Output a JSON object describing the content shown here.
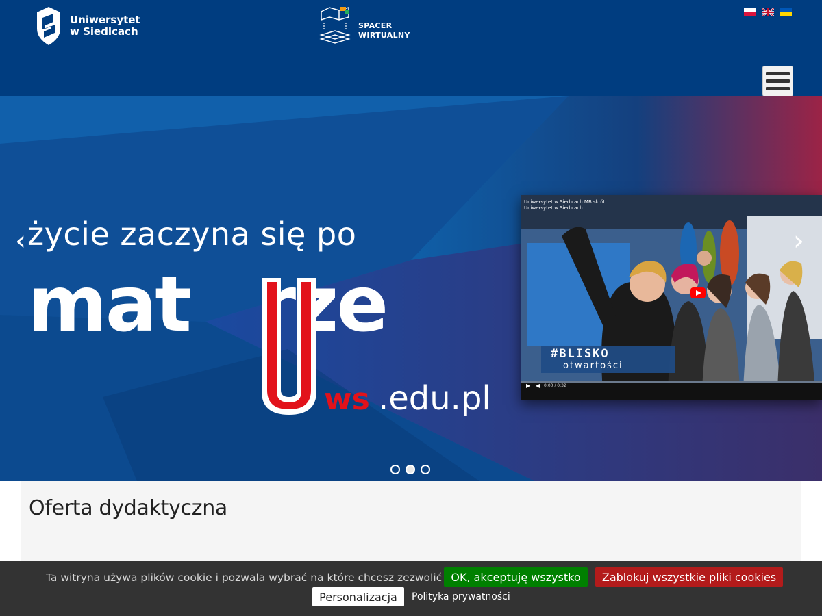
{
  "header": {
    "logo_line1": "Uniwersytet",
    "logo_line2": "w Siedlcach",
    "spacer_line1": "SPACER",
    "spacer_line2": "WIRTUALNY",
    "languages": [
      "pl",
      "en",
      "uk"
    ]
  },
  "hero": {
    "line1": "życie zaczyna się po",
    "big_left": "mat",
    "big_right": "rze",
    "ws": "ws",
    "edu": ".edu.pl",
    "prev_glyph": "‹",
    "next_glyph": "›",
    "video": {
      "caption_line1": "Uniwersytet w Siedlcach MB skrót",
      "caption_line2": "Uniwersytet w Siedlcach",
      "blisko": "#BLISKO",
      "otwartosci": "otwartości",
      "time": "0:00 / 0:32"
    },
    "slides_total": 3,
    "active_slide": 2
  },
  "content": {
    "heading": "Oferta dydaktyczna"
  },
  "cookie": {
    "message": "Ta witryna używa plików cookie i pozwala wybrać na które chcesz zezwolić",
    "accept_label": "OK, akceptuję wszystko",
    "block_label": "Zablokuj wszystkie pliki cookies",
    "personalize_label": "Personalizacja",
    "privacy_label": "Polityka prywatności"
  },
  "colors": {
    "header_bg": "#003d80",
    "accept_green": "#008000",
    "block_red": "#b31b1b",
    "cookie_bg": "#333333",
    "brand_red": "#e2121b"
  }
}
